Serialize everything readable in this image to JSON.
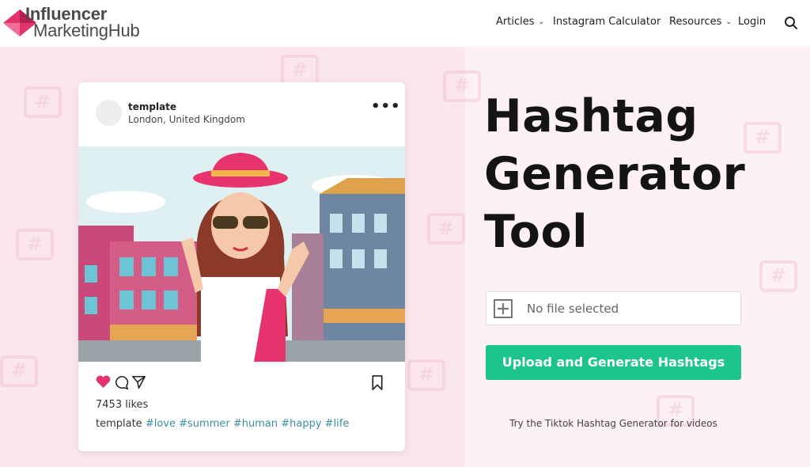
{
  "header": {
    "logo": {
      "line1": "Influencer",
      "line2": "MarketingHub"
    },
    "nav": [
      {
        "label": "Articles",
        "has_dropdown": true
      },
      {
        "label": "Instagram Calculator",
        "has_dropdown": false
      },
      {
        "label": "Resources",
        "has_dropdown": true
      },
      {
        "label": "Login",
        "has_dropdown": false
      }
    ],
    "search_icon": "search-icon"
  },
  "post_card": {
    "username": "template",
    "location": "London, United Kingdom",
    "more_icon": "more-dots-icon",
    "likes": "7453 likes",
    "caption_user": "template",
    "hashtags": [
      "#love",
      "#summer",
      "#human",
      "#happy",
      "#life"
    ],
    "icons": [
      "heart-icon",
      "comment-icon",
      "share-icon",
      "bookmark-icon"
    ]
  },
  "hero": {
    "title_lines": [
      "Hashtag",
      "Generator",
      "Tool"
    ],
    "file_input": {
      "text": "No file selected",
      "icon": "add-file-icon"
    },
    "upload_button": "Upload and Generate Hashtags",
    "tiktok_link": "Try the Tiktok Hashtag Generator for videos"
  },
  "colors": {
    "brand_pink": "#e2336b",
    "accent_green": "#1dc48d",
    "hero_bg_left": "#fbe5ee",
    "hero_bg_right": "#fdf1f5",
    "hashtag_color": "#3c8ea0"
  }
}
